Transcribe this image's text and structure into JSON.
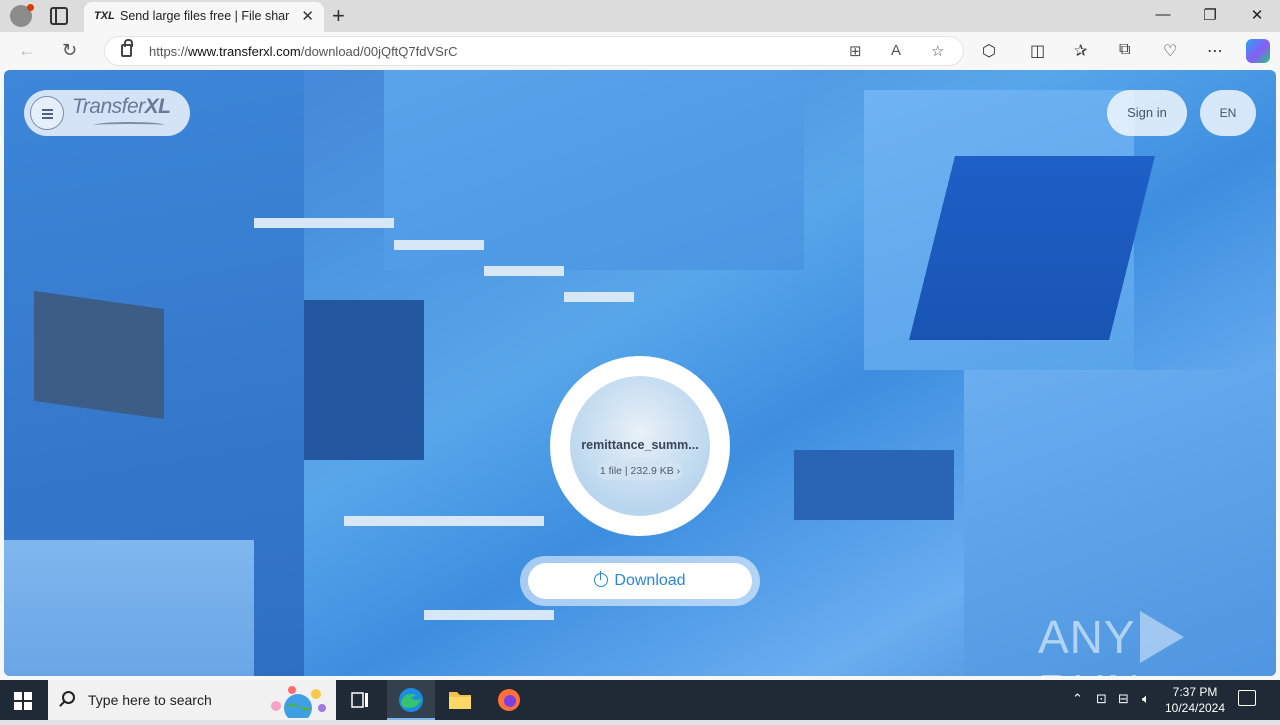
{
  "browser": {
    "tab": {
      "favicon_text": "TXL",
      "title": "Send large files free | File sharing",
      "close": "✕"
    },
    "new_tab": "+",
    "window_controls": {
      "minimize": "—",
      "restore": "❐",
      "close": "✕"
    },
    "url": {
      "prefix": "https://",
      "domain": "www.transferxl.com",
      "path": "/download/00jQftQ7fdVSrC"
    }
  },
  "page": {
    "logo": {
      "light": "Transfer",
      "bold": "XL"
    },
    "sign_in_label": "Sign in",
    "language_label": "EN",
    "file": {
      "name": "remittance_summ...",
      "meta": "1 file | 232.9 KB ›"
    },
    "download_label": "Download",
    "watermark": {
      "left": "ANY",
      "right": "RUN"
    }
  },
  "taskbar": {
    "search_placeholder": "Type here to search",
    "clock": {
      "time": "7:37 PM",
      "date": "10/24/2024"
    }
  }
}
